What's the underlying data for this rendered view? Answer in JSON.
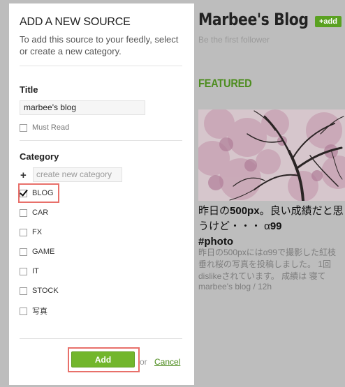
{
  "modal": {
    "title": "ADD A NEW SOURCE",
    "description": "To add this source to your feedly, select or create a new category.",
    "title_label": "Title",
    "title_value": "marbee's blog",
    "must_read_label": "Must Read",
    "category_label": "Category",
    "new_category_plus": "+",
    "new_category_placeholder": "create new category",
    "categories": [
      {
        "label": "BLOG",
        "checked": true
      },
      {
        "label": "CAR",
        "checked": false
      },
      {
        "label": "FX",
        "checked": false
      },
      {
        "label": "GAME",
        "checked": false
      },
      {
        "label": "IT",
        "checked": false
      },
      {
        "label": "STOCK",
        "checked": false
      },
      {
        "label": "写真",
        "checked": false
      }
    ],
    "add_label": "Add",
    "or_label": "or",
    "cancel_label": "Cancel"
  },
  "background": {
    "blog_title": "Marbee's Blog",
    "add_badge": "+add",
    "first_follower": "Be the first follower",
    "featured_label": "FEATURED",
    "article": {
      "title_part1": "昨日の",
      "title_bold1": "500px",
      "title_part2": "。良い成績だと思うけど・・・ α",
      "title_bold2": "99",
      "hashtag": "#photo",
      "body": "昨日の500pxにはα99で撮影した紅枝垂れ桜の写真を投稿しました。 1回dislikeされています。 成績は 寝て",
      "meta": "marbee's blog / 12h"
    }
  },
  "colors": {
    "accent_green": "#72b62c",
    "featured_green": "#4d8d1f",
    "highlight_red": "#e8706a"
  }
}
